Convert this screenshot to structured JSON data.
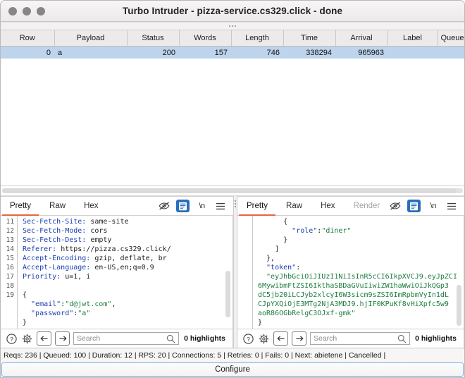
{
  "window": {
    "title": "Turbo Intruder - pizza-service.cs329.click - done",
    "controls": [
      "close",
      "minimize",
      "maximize"
    ]
  },
  "results_table": {
    "columns": [
      "Row",
      "Payload",
      "Status",
      "Words",
      "Length",
      "Time",
      "Arrival",
      "Label",
      "Queue ID"
    ],
    "rows": [
      {
        "row": "0",
        "payload": "a",
        "status": "200",
        "words": "157",
        "length": "746",
        "time": "338294",
        "arrival": "965963",
        "label": "",
        "queue_id": "",
        "selected": true
      }
    ]
  },
  "request_panel": {
    "tabs": [
      {
        "label": "Pretty",
        "active": true,
        "disabled": false
      },
      {
        "label": "Raw",
        "active": false,
        "disabled": false
      },
      {
        "label": "Hex",
        "active": false,
        "disabled": false
      }
    ],
    "tools": [
      {
        "name": "eye-slash-icon",
        "label": ""
      },
      {
        "name": "word-wrap-icon",
        "label": "",
        "active": true
      },
      {
        "name": "newline-toggle",
        "label": "\\n"
      },
      {
        "name": "hamburger-menu-icon",
        "label": ""
      }
    ],
    "line_numbers": [
      "11",
      "12",
      "13",
      "14",
      "15",
      "16",
      "17",
      "18",
      "19",
      "",
      "",
      ""
    ],
    "lines": [
      [
        {
          "t": "Sec-Fetch-Site:",
          "c": "k"
        },
        {
          "t": " same-site",
          "c": "v"
        }
      ],
      [
        {
          "t": "Sec-Fetch-Mode:",
          "c": "k"
        },
        {
          "t": " cors",
          "c": "v"
        }
      ],
      [
        {
          "t": "Sec-Fetch-Dest:",
          "c": "k"
        },
        {
          "t": " empty",
          "c": "v"
        }
      ],
      [
        {
          "t": "Referer:",
          "c": "k"
        },
        {
          "t": " https://pizza.cs329.click/",
          "c": "v"
        }
      ],
      [
        {
          "t": "Accept-Encoding:",
          "c": "k"
        },
        {
          "t": " gzip, deflate, br",
          "c": "v"
        }
      ],
      [
        {
          "t": "Accept-Language:",
          "c": "k"
        },
        {
          "t": " en-US,en;q=0.9",
          "c": "v"
        }
      ],
      [
        {
          "t": "Priority:",
          "c": "k"
        },
        {
          "t": " u=1, i",
          "c": "v"
        }
      ],
      [
        {
          "t": "",
          "c": "v"
        }
      ],
      [
        {
          "t": "{",
          "c": "p"
        }
      ],
      [
        {
          "t": "  \"email\"",
          "c": "k"
        },
        {
          "t": ":",
          "c": "p"
        },
        {
          "t": "\"d@jwt.com\"",
          "c": "s"
        },
        {
          "t": ",",
          "c": "p"
        }
      ],
      [
        {
          "t": "  \"password\"",
          "c": "k"
        },
        {
          "t": ":",
          "c": "p"
        },
        {
          "t": "\"a\"",
          "c": "s"
        }
      ],
      [
        {
          "t": "}",
          "c": "p"
        }
      ]
    ],
    "search": {
      "placeholder": "Search",
      "value": "",
      "highlights": "0 highlights"
    },
    "search_buttons": [
      "help-icon",
      "gear-icon",
      "previous-match-icon",
      "next-match-icon"
    ]
  },
  "response_panel": {
    "tabs": [
      {
        "label": "Pretty",
        "active": true,
        "disabled": false
      },
      {
        "label": "Raw",
        "active": false,
        "disabled": false
      },
      {
        "label": "Hex",
        "active": false,
        "disabled": false
      },
      {
        "label": "Render",
        "active": false,
        "disabled": true
      }
    ],
    "tools": [
      {
        "name": "eye-slash-icon",
        "label": ""
      },
      {
        "name": "word-wrap-icon",
        "label": "",
        "active": true
      },
      {
        "name": "newline-toggle",
        "label": "\\n"
      },
      {
        "name": "hamburger-menu-icon",
        "label": ""
      }
    ],
    "lines": [
      [
        {
          "t": "      {",
          "c": "p"
        }
      ],
      [
        {
          "t": "        \"role\"",
          "c": "k"
        },
        {
          "t": ":",
          "c": "p"
        },
        {
          "t": "\"diner\"",
          "c": "s"
        }
      ],
      [
        {
          "t": "      }",
          "c": "p"
        }
      ],
      [
        {
          "t": "    ]",
          "c": "p"
        }
      ],
      [
        {
          "t": "  },",
          "c": "p"
        }
      ],
      [
        {
          "t": "  \"token\"",
          "c": "k"
        },
        {
          "t": ":",
          "c": "p"
        }
      ],
      [
        {
          "t": "  \"eyJhbGciOiJIUzI1NiIsInR5cCI6IkpXVCJ9.eyJpZCI",
          "c": "s"
        }
      ],
      [
        {
          "t": "6MywibmFtZSI6IkthaSBDaGVuIiwiZW1haWwiOiJkQGp3",
          "c": "s"
        }
      ],
      [
        {
          "t": "dC5jb20iLCJyb2xlcyI6W3sicm9sZSI6ImRpbmVyIn1dL",
          "c": "s"
        }
      ],
      [
        {
          "t": "CJpYXQiOjE3MTg2NjA3MDJ9.hjIF0KPuKf8vHiXpfc5w9",
          "c": "s"
        }
      ],
      [
        {
          "t": "aoR86OGbRelgC3OJxf-gmk\"",
          "c": "s"
        }
      ],
      [
        {
          "t": "}",
          "c": "p"
        }
      ]
    ],
    "search": {
      "placeholder": "Search",
      "value": "",
      "highlights": "0 highlights"
    },
    "search_buttons": [
      "help-icon",
      "gear-icon",
      "previous-match-icon",
      "next-match-icon"
    ]
  },
  "status": {
    "text": "Reqs: 236 | Queued: 100 | Duration: 12 | RPS: 20 | Connections: 5 | Retries: 0 | Fails: 0 | Next: abietene | Cancelled |"
  },
  "configure": {
    "label": "Configure"
  },
  "colors": {
    "accent_tab": "#e8663b",
    "selection_row": "#bed3ec",
    "tool_active": "#2a6ebb",
    "header_key": "#1b3fb0",
    "string_value": "#1d7d3f",
    "titlebar": "#f1efee"
  }
}
